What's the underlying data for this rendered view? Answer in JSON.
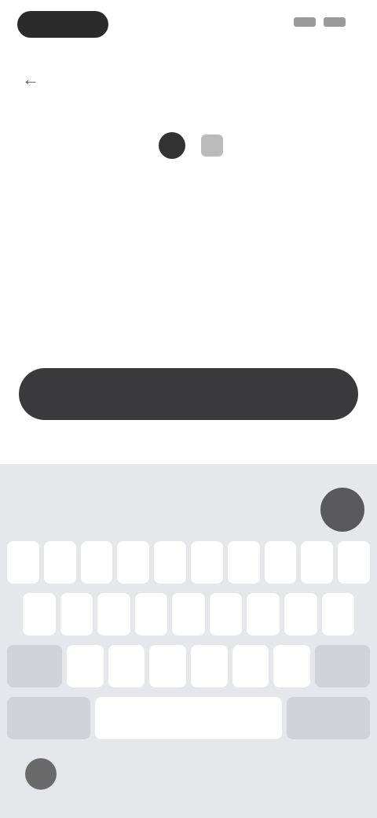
{
  "status": {
    "pill_label": ""
  },
  "nav": {
    "back_icon": "arrow-left-icon",
    "progress_label": "",
    "skip_label": ""
  },
  "main": {
    "headline_part1": "",
    "headline_part2": "",
    "subtext": ""
  },
  "cta": {
    "label": ""
  },
  "keyboard": {
    "rows": [
      [
        "",
        "",
        "",
        "",
        "",
        "",
        "",
        "",
        "",
        ""
      ],
      [
        "",
        "",
        "",
        "",
        "",
        "",
        "",
        "",
        ""
      ],
      [
        "",
        "",
        "",
        "",
        "",
        "",
        "",
        ""
      ],
      [
        "",
        "",
        ""
      ]
    ]
  },
  "colors": {
    "cta_bg": "#3a3a3c",
    "keyboard_bg": "#e6e7ea"
  }
}
